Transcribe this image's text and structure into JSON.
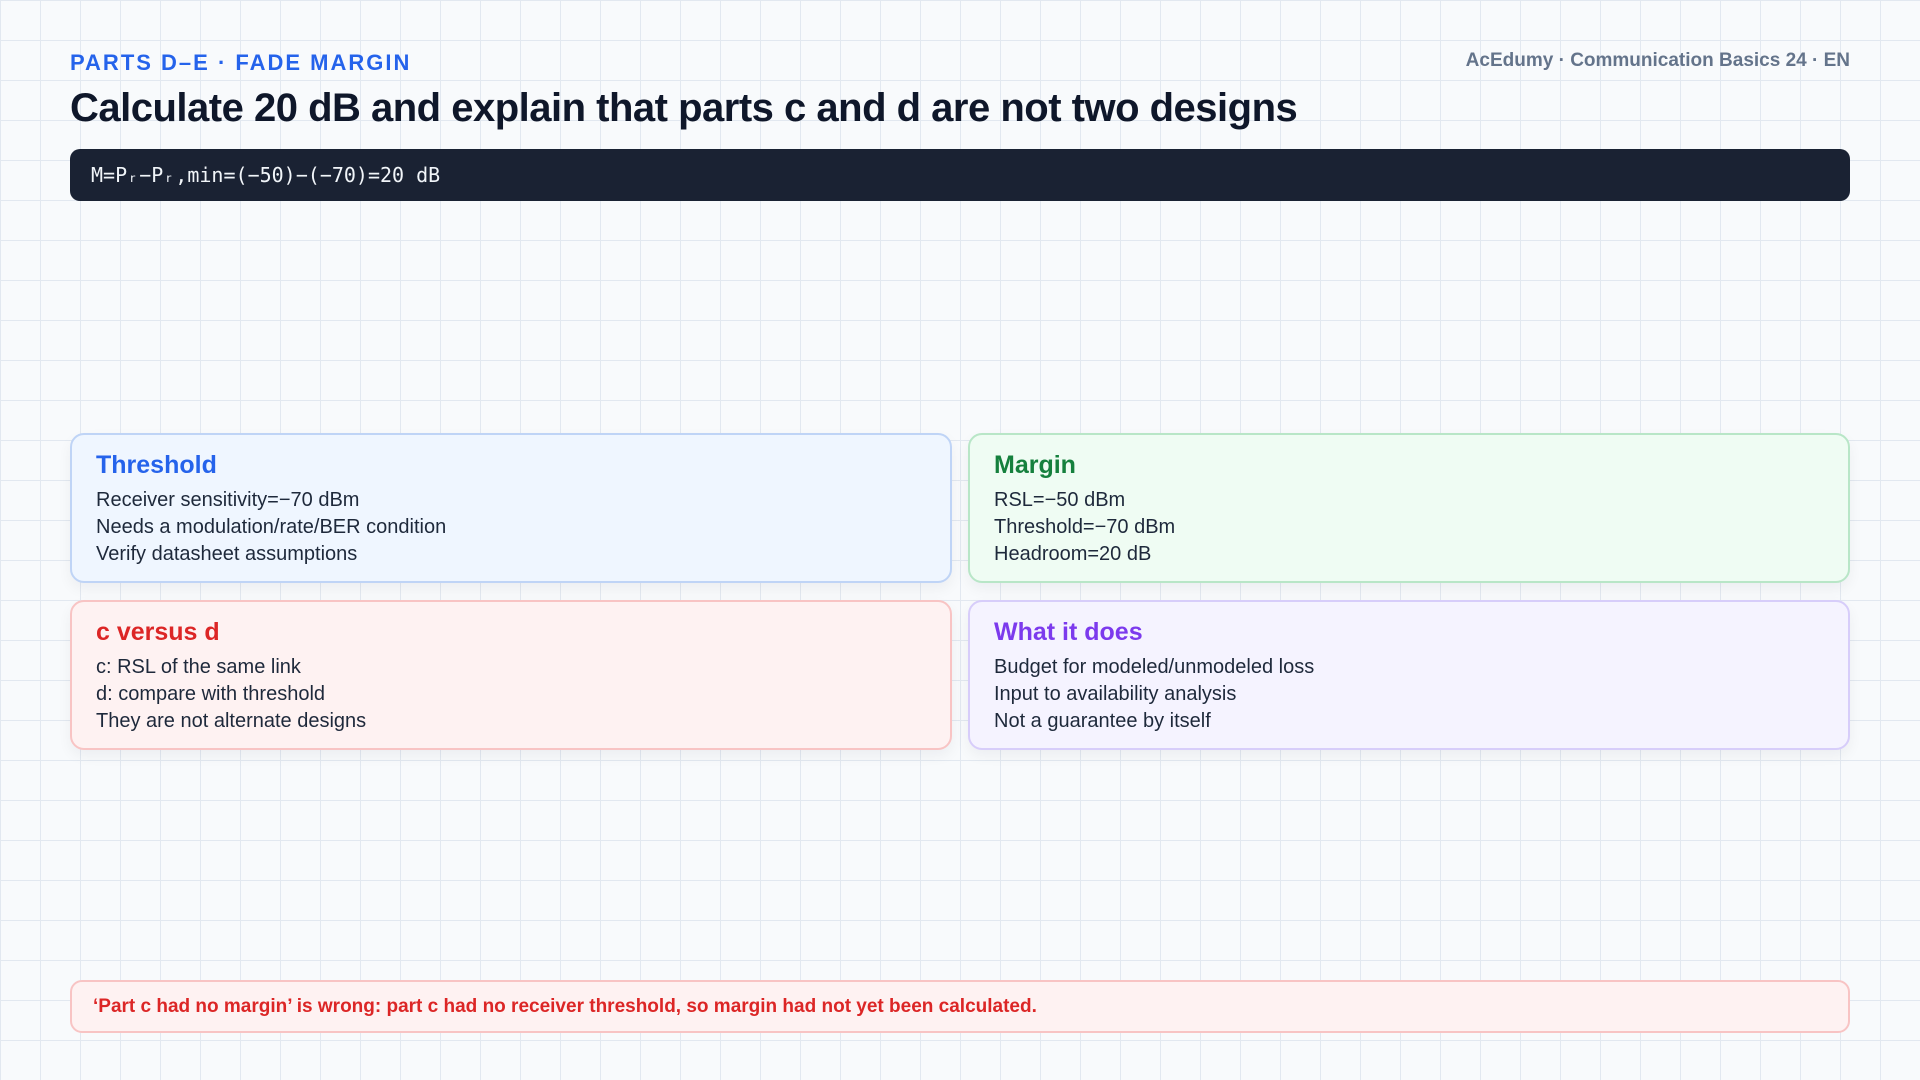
{
  "header": {
    "kicker": "PARTS D–E · FADE MARGIN",
    "brand": "AcEdumy · Communication Basics 24 · EN",
    "title": "Calculate 20 dB and explain that parts c and d are not two designs"
  },
  "formula": "M=Pᵣ−Pᵣ,min=(−50)−(−70)=20 dB",
  "cards": [
    {
      "title": "Threshold",
      "lines": [
        "Receiver sensitivity=−70 dBm",
        "Needs a modulation/rate/BER condition",
        "Verify datasheet assumptions"
      ],
      "accent": "#2563eb"
    },
    {
      "title": "Margin",
      "lines": [
        "RSL=−50 dBm",
        "Threshold=−70 dBm",
        "Headroom=20 dB"
      ],
      "accent": "#15803d"
    },
    {
      "title": "c versus d",
      "lines": [
        "c: RSL of the same link",
        "d: compare with threshold",
        "They are not alternate designs"
      ],
      "accent": "#dc2626"
    },
    {
      "title": "What it does",
      "lines": [
        "Budget for modeled/unmodeled loss",
        "Input to availability analysis",
        "Not a guarantee by itself"
      ],
      "accent": "#7c3aed"
    }
  ],
  "note": "‘Part c had no margin’ is wrong: part c had no receiver threshold, so margin had not yet been calculated."
}
